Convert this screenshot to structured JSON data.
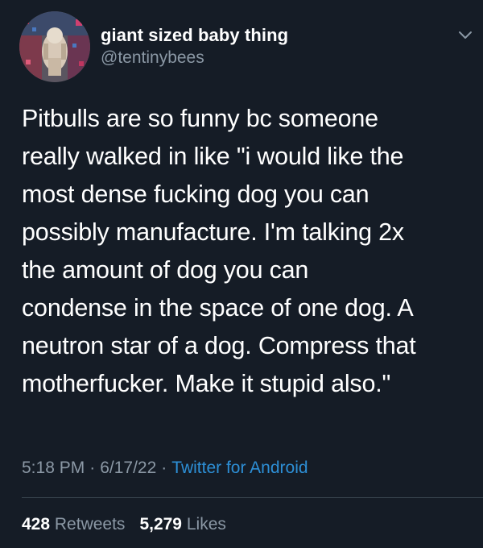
{
  "user": {
    "display_name": "giant sized baby thing",
    "handle": "@tentinybees"
  },
  "tweet": {
    "lines": [
      "Pitbulls are so funny bc someone",
      "really walked in like \"i would like the",
      "most dense fucking dog you can",
      "possibly manufacture. I'm talking 2x",
      "the amount of dog you can",
      "condense in the space of one dog. A",
      "neutron star of a dog. Compress that",
      "motherfucker. Make it stupid also.\""
    ],
    "time": "5:18 PM",
    "date": "6/17/22",
    "source": "Twitter for Android",
    "separator": "·"
  },
  "stats": {
    "retweets_count": "428",
    "retweets_label": "Retweets",
    "likes_count": "5,279",
    "likes_label": "Likes"
  },
  "colors": {
    "background": "#151c26",
    "text": "#ffffff",
    "muted": "#8b98a5",
    "link": "#2d8fd6",
    "divider": "#38444d"
  },
  "icons": {
    "more": "chevron-down-icon"
  }
}
